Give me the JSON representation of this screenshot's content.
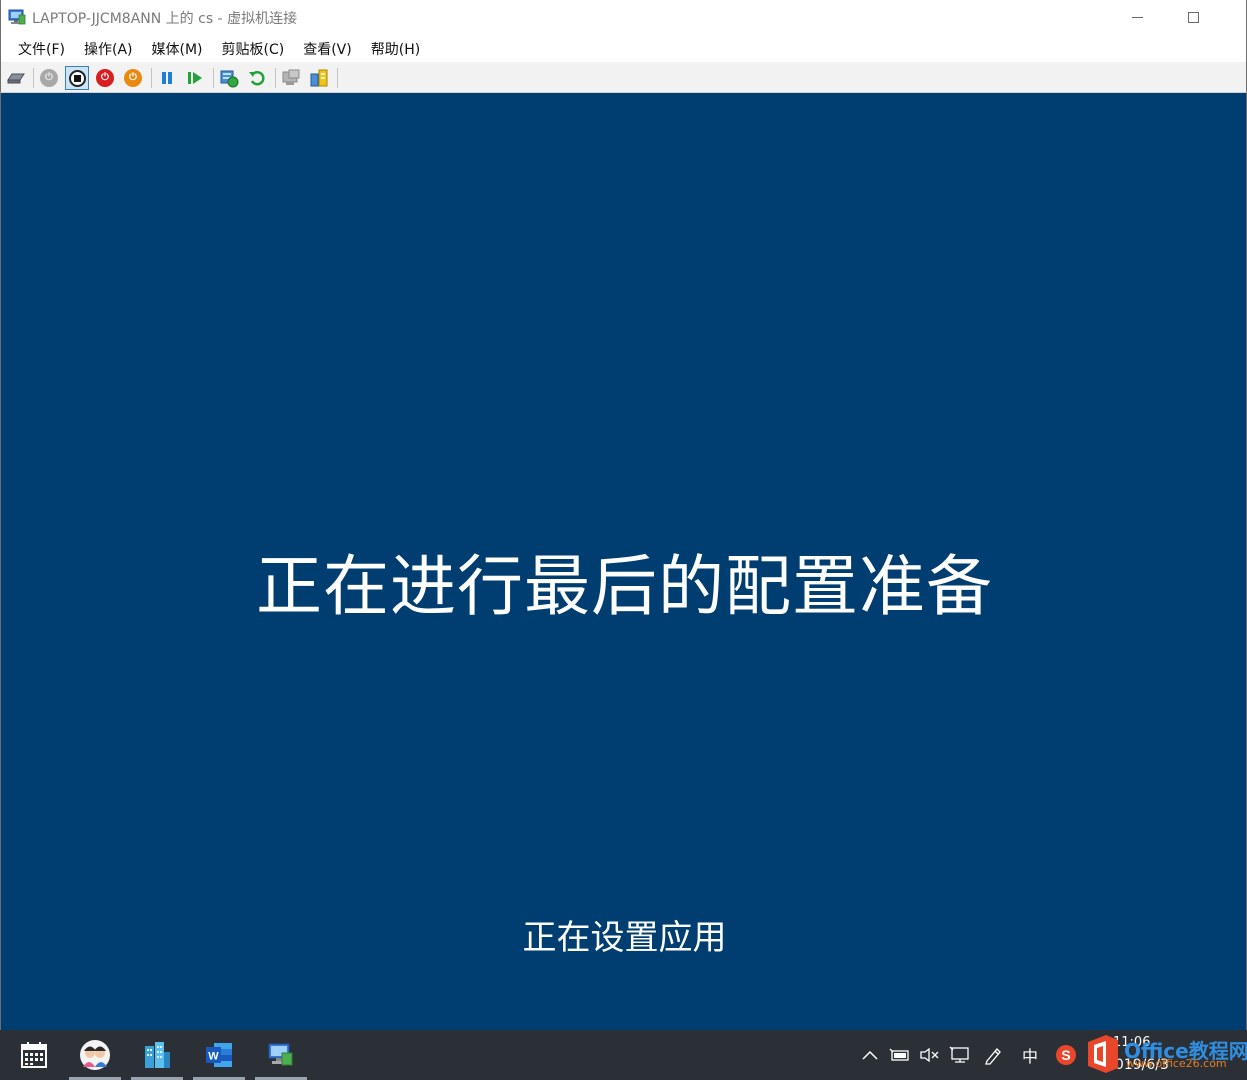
{
  "window": {
    "title": "LAPTOP-JJCM8ANN 上的 cs - 虚拟机连接",
    "icon": "vm-connect-icon"
  },
  "menu": {
    "items": [
      {
        "label": "文件(F)"
      },
      {
        "label": "操作(A)"
      },
      {
        "label": "媒体(M)"
      },
      {
        "label": "剪贴板(C)"
      },
      {
        "label": "查看(V)"
      },
      {
        "label": "帮助(H)"
      }
    ]
  },
  "toolbar": {
    "buttons": [
      {
        "icon": "ctrl-alt-del-icon"
      },
      {
        "icon": "start-icon"
      },
      {
        "icon": "turn-off-icon",
        "pressed": true
      },
      {
        "icon": "shutdown-icon"
      },
      {
        "icon": "save-state-icon"
      },
      {
        "icon": "pause-icon"
      },
      {
        "icon": "resume-icon"
      },
      {
        "icon": "checkpoint-icon"
      },
      {
        "icon": "revert-icon"
      },
      {
        "icon": "enhanced-session-icon"
      },
      {
        "icon": "share-icon"
      }
    ],
    "colors": {
      "shutdown": "#d81e1e",
      "save": "#e88a12",
      "pause": "#1f7fd4",
      "resume": "#22a33a"
    }
  },
  "screen": {
    "background": "#003e72",
    "main_message": "正在进行最后的配置准备",
    "sub_message": "正在设置应用"
  },
  "taskbar": {
    "pinned": [
      {
        "icon": "calendar-icon"
      },
      {
        "icon": "avatar-app-icon"
      },
      {
        "icon": "buildings-app-icon"
      },
      {
        "icon": "word-icon"
      },
      {
        "icon": "hyperv-icon"
      }
    ],
    "tray": {
      "input_method": "中",
      "time": "11:06",
      "date": "2019/6/3"
    },
    "watermark": {
      "text": "Office教程网",
      "url": "www.office26.com"
    }
  }
}
